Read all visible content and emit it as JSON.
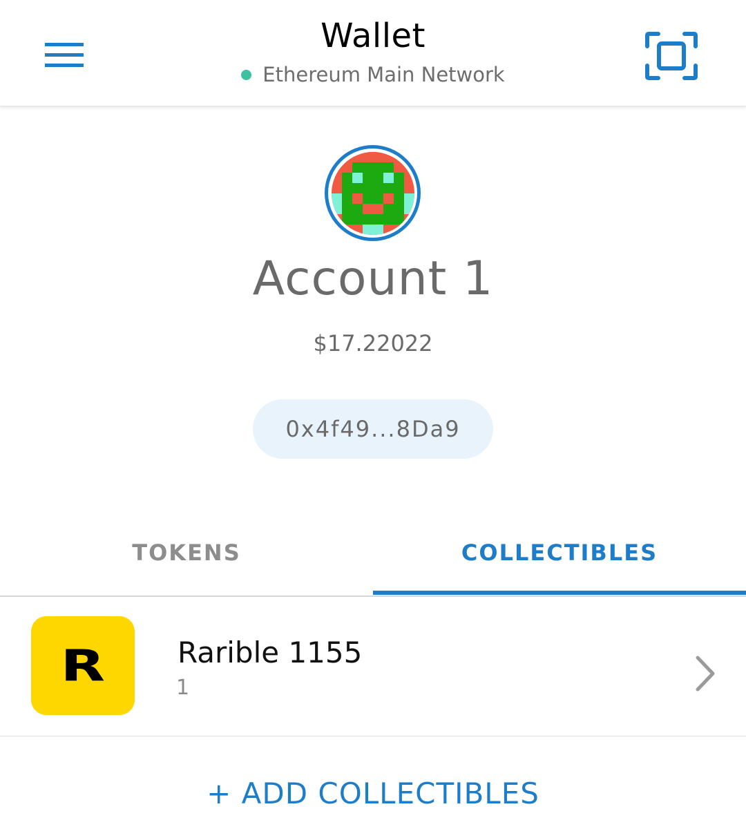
{
  "header": {
    "title": "Wallet",
    "network_label": "Ethereum Main Network",
    "network_status_color": "#3cc29e",
    "menu_icon": "menu-icon",
    "scan_icon": "scan-icon"
  },
  "account": {
    "name": "Account 1",
    "balance": "$17.22022",
    "address": "0x4f49...8Da9",
    "avatar_colors": [
      "#f05a43",
      "#1daa10",
      "#7ff1d6"
    ]
  },
  "tabs": [
    {
      "label": "TOKENS",
      "active": false
    },
    {
      "label": "COLLECTIBLES",
      "active": true
    }
  ],
  "collectibles": [
    {
      "icon_letter": "R",
      "name": "Rarible 1155",
      "count": "1",
      "icon_color": "#fed700"
    }
  ],
  "actions": {
    "add_collectibles": "+ ADD COLLECTIBLES"
  },
  "colors": {
    "accent": "#1e7dc8"
  }
}
